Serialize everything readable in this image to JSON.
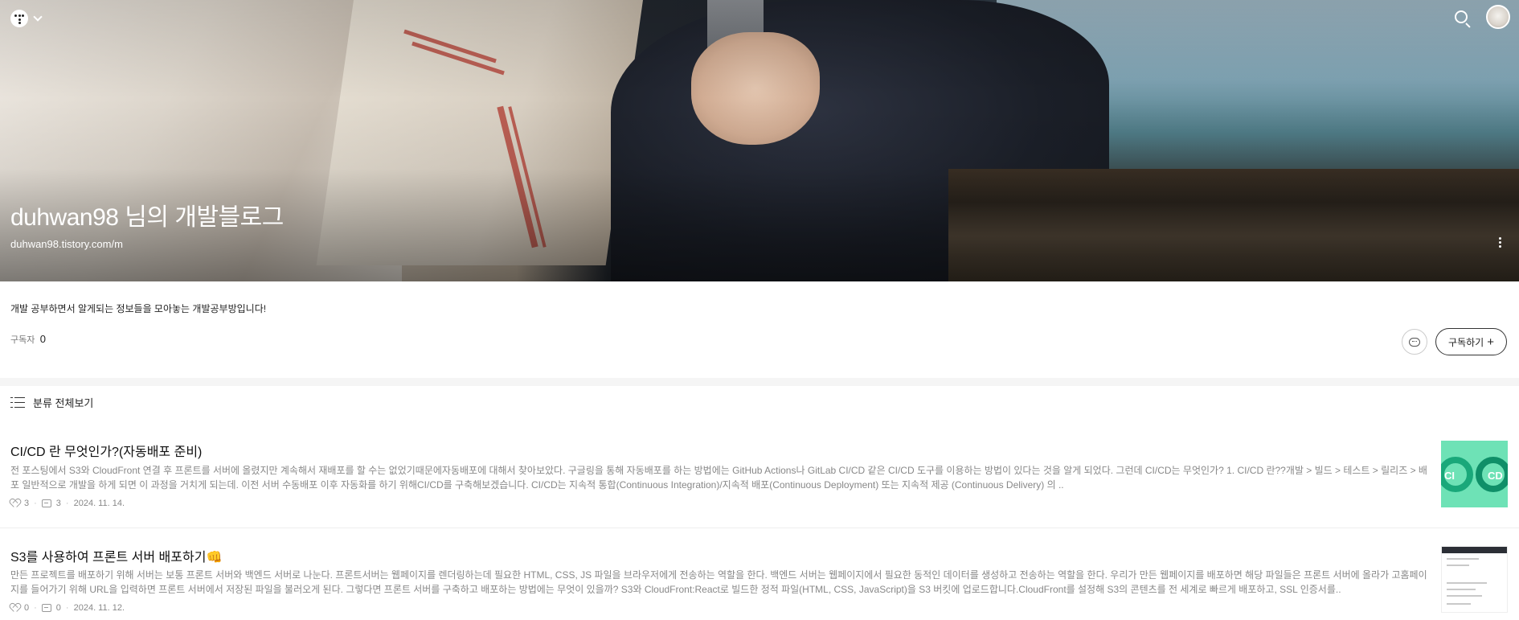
{
  "header": {
    "blog_title": "duhwan98 님의 개발블로그",
    "blog_url": "duhwan98.tistory.com/m"
  },
  "profile": {
    "intro": "개발 공부하면서 알게되는 정보들을 모아놓는 개발공부방입니다!",
    "subscriber_label": "구독자",
    "subscriber_count": "0",
    "subscribe_label": "구독하기",
    "subscribe_plus": "+"
  },
  "category": {
    "label": "분류 전체보기"
  },
  "posts": [
    {
      "title": "CI/CD 란 무엇인가?(자동배포 준비)",
      "excerpt": "전 포스팅에서 S3와 CloudFront 연결 후 프론트를 서버에 올렸지만 계속해서 재배포를 할 수는 없었기때문에자동배포에 대해서 찾아보았다. 구글링을 통해 자동배포를 하는 방법에는 GitHub Actions나 GitLab CI/CD 같은 CI/CD 도구를 이용하는 방법이 있다는 것을 알게 되었다. 그런데 CI/CD는 무엇인가?  1. CI/CD 란??개발 > 빌드 > 테스트 > 릴리즈 > 배포 일반적으로 개발을 하게 되면 이 과정을 거치게 되는데. 이전 서버 수동배포 이후 자동화를 하기 위해CI/CD를 구축해보겠습니다.  CI/CD는 지속적 통합(Continuous Integration)/지속적 배포(Continuous Deployment) 또는 지속적 제공 (Continuous Delivery) 의 ..",
      "likes": "3",
      "comments": "3",
      "date": "2024. 11. 14.",
      "thumb_left": "CI",
      "thumb_right": "CD"
    },
    {
      "title": "S3를 사용하여 프론트 서버 배포하기",
      "title_emoji": "👊",
      "excerpt": "만든 프로젝트를 배포하기 위해 서버는 보통 프론트 서버와 백엔드 서버로 나눈다. 프론트서버는 웹페이지를 렌더링하는데 필요한 HTML, CSS, JS 파일을 브라우저에게 전송하는 역할을 한다. 백엔드 서버는 웹페이지에서 필요한 동적인 데이터를 생성하고 전송하는 역할을 한다. 우리가 만든 웹페이지를 배포하면 해당 파일들은 프론트 서버에 올라가 고홈페이지를 들어가기 위해 URL을 입력하면 프론트 서버에서 저장된 파일을 불러오게 된다. 그렇다면 프론트 서버를 구축하고 배포하는 방법에는 무엇이 있을까?  S3와 CloudFront:React로 빌드한 정적 파일(HTML, CSS, JavaScript)을 S3 버킷에 업로드합니다.CloudFront를 설정해 S3의 콘텐츠를 전 세계로 빠르게 배포하고, SSL 인증서를..",
      "likes": "0",
      "comments": "0",
      "date": "2024. 11. 12."
    }
  ],
  "icons": {
    "logo": "tistory-logo-icon",
    "search": "search-icon",
    "avatar": "user-avatar",
    "more": "more-vertical-icon",
    "chat": "chat-bubble-icon",
    "list": "list-icon",
    "like": "heart-icon",
    "comment": "comment-icon"
  }
}
